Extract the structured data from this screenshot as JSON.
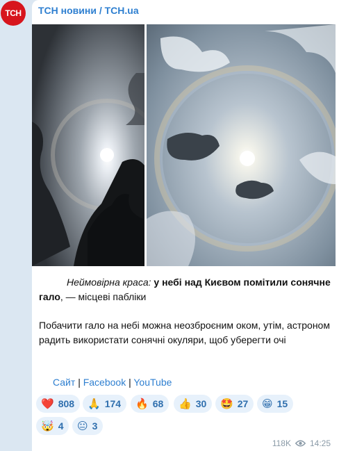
{
  "channel": {
    "avatar_text": "TCH",
    "name": "ТСН новини / TCH.ua"
  },
  "post": {
    "caption_italic": "Неймовірна краса:",
    "caption_bold": "у небі над Києвом помітили сонячне гало",
    "caption_rest": ", — місцеві пабліки",
    "paragraph": "Побачити гало на небі можна неозброєним оком, утім, астроном радить використати сонячні окуляри, щоб уберегти очі",
    "links": [
      "Сайт",
      "Facebook",
      "YouTube"
    ],
    "separator": "|",
    "reactions": [
      {
        "emoji": "❤️",
        "icon": "heart-icon",
        "count": "808"
      },
      {
        "emoji": "🙏",
        "icon": "pray-icon",
        "count": "174"
      },
      {
        "emoji": "🔥",
        "icon": "fire-icon",
        "count": "68"
      },
      {
        "emoji": "👍",
        "icon": "thumbs-up-icon",
        "count": "30"
      },
      {
        "emoji": "🤩",
        "icon": "star-struck-icon",
        "count": "27"
      },
      {
        "emoji": "😁",
        "icon": "grin-icon",
        "count": "15"
      },
      {
        "emoji": "🤯",
        "icon": "mind-blown-icon",
        "count": "4"
      },
      {
        "emoji": "😐",
        "icon": "neutral-face-icon",
        "count": "3"
      }
    ],
    "views": "118K",
    "time": "14:25"
  },
  "colors": {
    "accent": "#2e7fd0",
    "avatar_bg": "#d7151d",
    "reaction_bg": "#e7f1fb",
    "chat_bg": "#dbe7f2"
  }
}
